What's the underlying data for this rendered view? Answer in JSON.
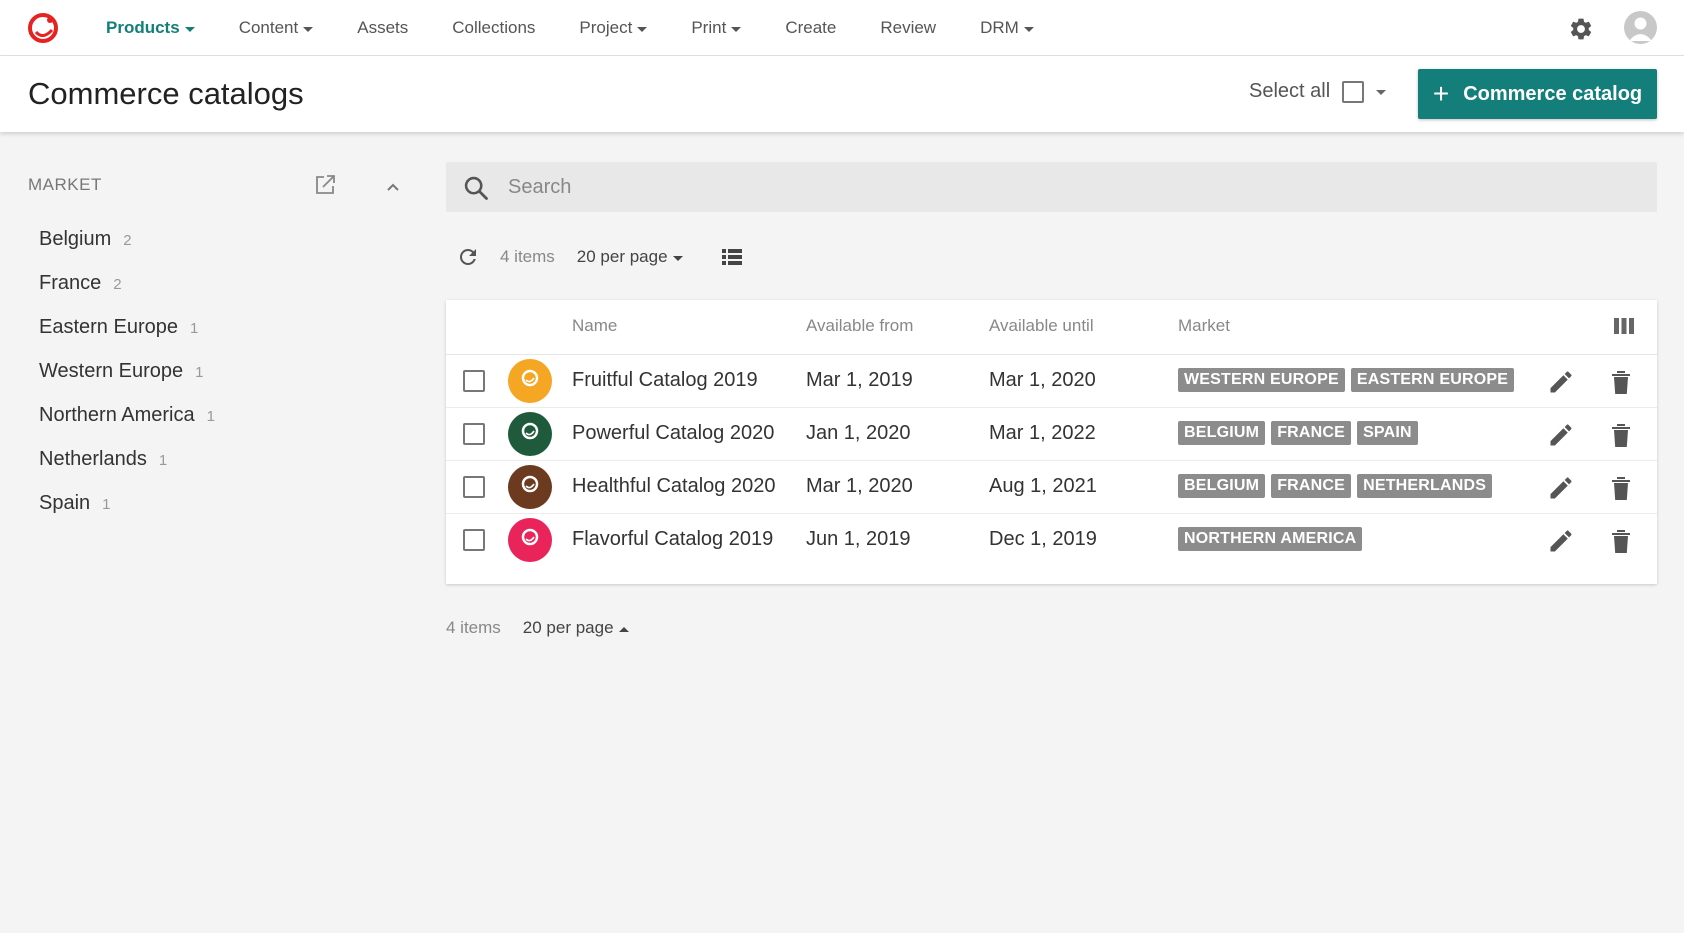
{
  "nav": {
    "items": [
      {
        "label": "Products",
        "dropdown": true,
        "active": true
      },
      {
        "label": "Content",
        "dropdown": true,
        "active": false
      },
      {
        "label": "Assets",
        "dropdown": false,
        "active": false
      },
      {
        "label": "Collections",
        "dropdown": false,
        "active": false
      },
      {
        "label": "Project",
        "dropdown": true,
        "active": false
      },
      {
        "label": "Print",
        "dropdown": true,
        "active": false
      },
      {
        "label": "Create",
        "dropdown": false,
        "active": false
      },
      {
        "label": "Review",
        "dropdown": false,
        "active": false
      },
      {
        "label": "DRM",
        "dropdown": true,
        "active": false
      }
    ],
    "icons": {
      "logo": "logo-icon",
      "settings": "gear-icon",
      "user": "user-avatar-icon"
    }
  },
  "header": {
    "title": "Commerce catalogs",
    "select_all_label": "Select all",
    "add_button_label": "Commerce catalog"
  },
  "facets": {
    "title": "MARKET",
    "items": [
      {
        "label": "Belgium",
        "count": "2"
      },
      {
        "label": "France",
        "count": "2"
      },
      {
        "label": "Eastern Europe",
        "count": "1"
      },
      {
        "label": "Western Europe",
        "count": "1"
      },
      {
        "label": "Northern America",
        "count": "1"
      },
      {
        "label": "Netherlands",
        "count": "1"
      },
      {
        "label": "Spain",
        "count": "1"
      }
    ]
  },
  "search": {
    "placeholder": "Search",
    "value": ""
  },
  "toolbar": {
    "items_count": "4 items",
    "per_page": "20 per page"
  },
  "table": {
    "columns": {
      "name": "Name",
      "available_from": "Available from",
      "available_until": "Available until",
      "market": "Market"
    },
    "rows": [
      {
        "name": "Fruitful Catalog 2019",
        "from": "Mar 1, 2019",
        "until": "Mar 1, 2020",
        "markets": [
          "WESTERN EUROPE",
          "EASTERN EUROPE"
        ],
        "thumb_color": "#f5a623"
      },
      {
        "name": "Powerful Catalog 2020",
        "from": "Jan 1, 2020",
        "until": "Mar 1, 2022",
        "markets": [
          "BELGIUM",
          "FRANCE",
          "SPAIN"
        ],
        "thumb_color": "#1f5a3c"
      },
      {
        "name": "Healthful Catalog 2020",
        "from": "Mar 1, 2020",
        "until": "Aug 1, 2021",
        "markets": [
          "BELGIUM",
          "FRANCE",
          "NETHERLANDS"
        ],
        "thumb_color": "#6b3a1f"
      },
      {
        "name": "Flavorful Catalog 2019",
        "from": "Jun 1, 2019",
        "until": "Dec 1, 2019",
        "markets": [
          "NORTHERN AMERICA"
        ],
        "thumb_color": "#e8245a"
      }
    ]
  },
  "footer": {
    "items_count": "4 items",
    "per_page": "20 per page"
  },
  "colors": {
    "accent": "#137e7a",
    "tag": "#8c8c8c",
    "logo": "#e52421"
  }
}
